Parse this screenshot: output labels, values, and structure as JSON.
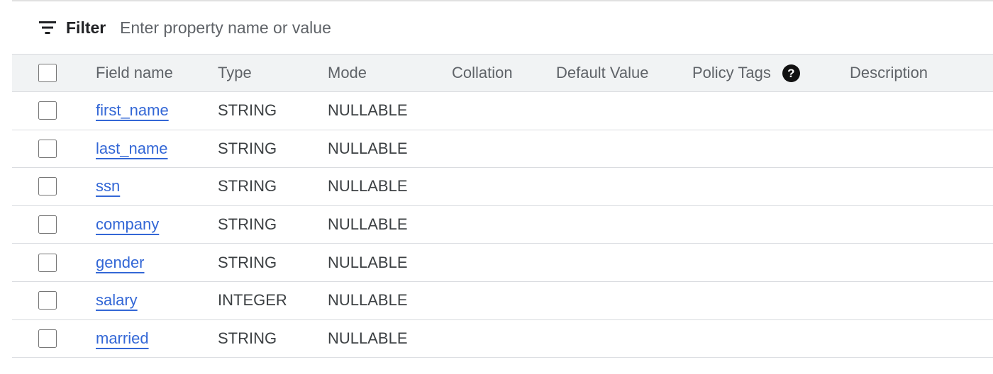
{
  "filter": {
    "label": "Filter",
    "placeholder": "Enter property name or value",
    "value": "",
    "icon": "filter-list-icon"
  },
  "table": {
    "headers": {
      "field_name": "Field name",
      "type": "Type",
      "mode": "Mode",
      "collation": "Collation",
      "default_value": "Default Value",
      "policy_tags": "Policy Tags",
      "policy_tags_help_icon": "help-icon",
      "description": "Description"
    },
    "rows": [
      {
        "field_name": "first_name",
        "type": "STRING",
        "mode": "NULLABLE",
        "collation": "",
        "default_value": "",
        "policy_tags": "",
        "description": ""
      },
      {
        "field_name": "last_name",
        "type": "STRING",
        "mode": "NULLABLE",
        "collation": "",
        "default_value": "",
        "policy_tags": "",
        "description": ""
      },
      {
        "field_name": "ssn",
        "type": "STRING",
        "mode": "NULLABLE",
        "collation": "",
        "default_value": "",
        "policy_tags": "",
        "description": ""
      },
      {
        "field_name": "company",
        "type": "STRING",
        "mode": "NULLABLE",
        "collation": "",
        "default_value": "",
        "policy_tags": "",
        "description": ""
      },
      {
        "field_name": "gender",
        "type": "STRING",
        "mode": "NULLABLE",
        "collation": "",
        "default_value": "",
        "policy_tags": "",
        "description": ""
      },
      {
        "field_name": "salary",
        "type": "INTEGER",
        "mode": "NULLABLE",
        "collation": "",
        "default_value": "",
        "policy_tags": "",
        "description": ""
      },
      {
        "field_name": "married",
        "type": "STRING",
        "mode": "NULLABLE",
        "collation": "",
        "default_value": "",
        "policy_tags": "",
        "description": ""
      }
    ]
  },
  "colors": {
    "link": "#3367d6",
    "header_bg": "#f1f3f4",
    "divider": "#dadce0"
  }
}
